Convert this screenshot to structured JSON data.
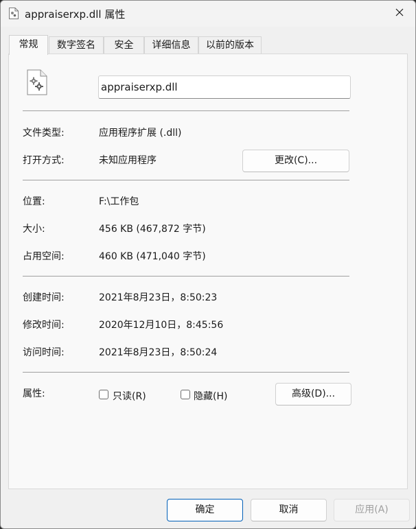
{
  "window": {
    "title": "appraiserxp.dll 属性"
  },
  "tabs": [
    {
      "label": "常规",
      "active": true
    },
    {
      "label": "数字签名",
      "active": false
    },
    {
      "label": "安全",
      "active": false
    },
    {
      "label": "详细信息",
      "active": false
    },
    {
      "label": "以前的版本",
      "active": false
    }
  ],
  "general": {
    "file_name": "appraiserxp.dll",
    "file_type_label": "文件类型:",
    "file_type_value": "应用程序扩展 (.dll)",
    "opens_with_label": "打开方式:",
    "opens_with_value": "未知应用程序",
    "change_button": "更改(C)...",
    "location_label": "位置:",
    "location_value": "F:\\工作包",
    "size_label": "大小:",
    "size_value": "456 KB (467,872 字节)",
    "size_on_disk_label": "占用空间:",
    "size_on_disk_value": "460 KB (471,040 字节)",
    "created_label": "创建时间:",
    "created_value": "2021年8月23日，8:50:23",
    "modified_label": "修改时间:",
    "modified_value": "2020年12月10日，8:45:56",
    "accessed_label": "访问时间:",
    "accessed_value": "2021年8月23日，8:50:24",
    "attributes_label": "属性:",
    "readonly_label": "只读(R)",
    "readonly_checked": false,
    "hidden_label": "隐藏(H)",
    "hidden_checked": false,
    "advanced_button": "高级(D)..."
  },
  "footer": {
    "ok_button": "确定",
    "cancel_button": "取消",
    "apply_button": "应用(A)"
  },
  "colors": {
    "primary_border": "#005fb8",
    "panel_bg": "#f9f9f9",
    "window_bg": "#f0f0f0"
  }
}
